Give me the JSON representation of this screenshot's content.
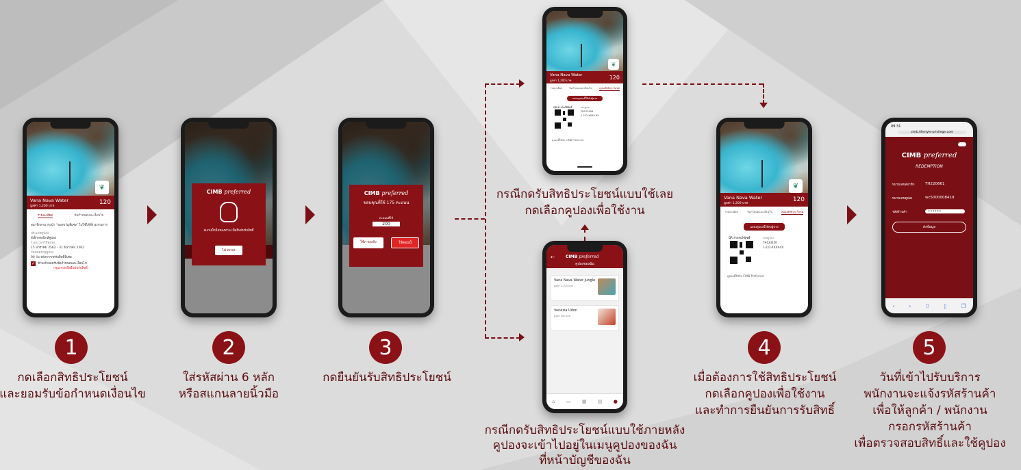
{
  "hotel": {
    "name": "Vana Nava Water",
    "price": "มูลค่า 1,200 บาท",
    "points_label": "คะแนน",
    "points": "120"
  },
  "tabs": {
    "detail": "รายละเอียด",
    "terms": "ข้อกำหนดและเงื่อนไข",
    "coupon": "คูปองสิทธิประโยชน์"
  },
  "step1": {
    "desc": "สมาชิกสามารถนำ \"ของขวัญพิเศษ\" ไปใช้ได้ที่ร่วมรายการ",
    "type_label": "ประเภทคูปอง",
    "type_value": "อีเล็กทรอนิกส์คูปอง",
    "period_label": "ระยะเวลาใช้คูปอง",
    "period_value": "15 มกราคม 2562 - 31 ธันวาคม 2562",
    "expire_label": "วันหมดอายุคูปอง",
    "expire_value": "90 วัน หลังจากกดรับสิทธิ์พิเศษ",
    "accept_label": "ข้าพเจ้ายอมรับข้อกำหนดและเงื่อนไข",
    "redeem_link": "กรุณากดเพื่อยืนยันรับสิทธิ์"
  },
  "step2": {
    "logo": "CIMB",
    "logo_italic": "preferred",
    "prompt": "สแกนนิ้วมือของท่าน เพื่อยืนยันรับสิทธิ์",
    "cancel": "ไม่ ตกลง"
  },
  "step3": {
    "logo": "CIMB",
    "logo_italic": "preferred",
    "title": "ขอบคุณที่ใช้ 175 คะแนน",
    "qty_label": "คะแนนที่ใช้",
    "qty": "200",
    "btn_later": "ใช้ภายหลัง",
    "btn_now": "ใช้ตอนนี้"
  },
  "coupon_screen": {
    "btn": "แสดงคูปองนี้ให้กับผู้ขาย",
    "qr_label": "QR สำหรับใช้สิทธิ์",
    "code_label": "เลขคูปอง",
    "code": "TH123456",
    "phone": "1-222-XXXX-XX",
    "footer": "คูปองนี้ใช้กับ CIMB Preferred"
  },
  "coupon_list": {
    "title": "คูปองของฉัน",
    "brand": "CIMB",
    "brand_italic": "preferred",
    "items": [
      {
        "name": "Vana Nava Water Jungle",
        "sub": "มูลค่า 1,200 บาท"
      },
      {
        "name": "Venezia Udon",
        "sub": "มูลค่า 500 บาท"
      }
    ],
    "nav": "บัญชีของฉัน"
  },
  "browser": {
    "time": "09:31",
    "url": "cimb.lifestyle-privilege.com",
    "logo": "CIMB",
    "logo_italic": "preferred",
    "title": "REDEMPTION",
    "member_label": "หมายเลขสมาชิก",
    "member_value": "TH220661",
    "coupon_label": "หมายเลขคูปอง",
    "coupon_value": "wc5000008419",
    "shop_label": "รหัสร้านค้า",
    "shop_value": "••••••",
    "submit": "ส่งข้อมูล"
  },
  "captions": {
    "c1": [
      "กดเลือกสิทธิประโยชน์",
      "และยอมรับข้อกำหนดเงื่อนไข"
    ],
    "c2": [
      "ใส่รหัสผ่าน 6 หลัก",
      "หรือสแกนลายนิ้วมือ"
    ],
    "c3": [
      "กดยืนยันรับสิทธิประโยชน์"
    ],
    "top": [
      "กรณีกดรับสิทธิประโยชน์แบบใช้เลย",
      "กดเลือกคูปองเพื่อใช้งาน"
    ],
    "bottom": [
      "กรณีกดรับสิทธิประโยชน์แบบใช้ภายหลัง",
      "คูปองจะเข้าไปอยู่ในเมนูคูปองของฉัน",
      "ที่หน้าบัญชีของฉัน"
    ],
    "c4": [
      "เมื่อต้องการใช้สิทธิประโยชน์",
      "กดเลือกคูปองเพื่อใช้งาน",
      "และทำการยืนยันการรับสิทธิ์"
    ],
    "c5": [
      "วันที่เข้าไปรับบริการ",
      "พนักงานจะแจ้งรหัสร้านค้า",
      "เพื่อให้ลูกค้า / พนักงาน",
      "กรอกรหัสร้านค้า",
      "เพื่อตรวจสอบสิทธิ์และใช้คูปอง"
    ]
  },
  "steps": [
    "1",
    "2",
    "3",
    "4",
    "5"
  ],
  "colors": {
    "brand": "#8a1217",
    "dark_red": "#5a0d10"
  }
}
